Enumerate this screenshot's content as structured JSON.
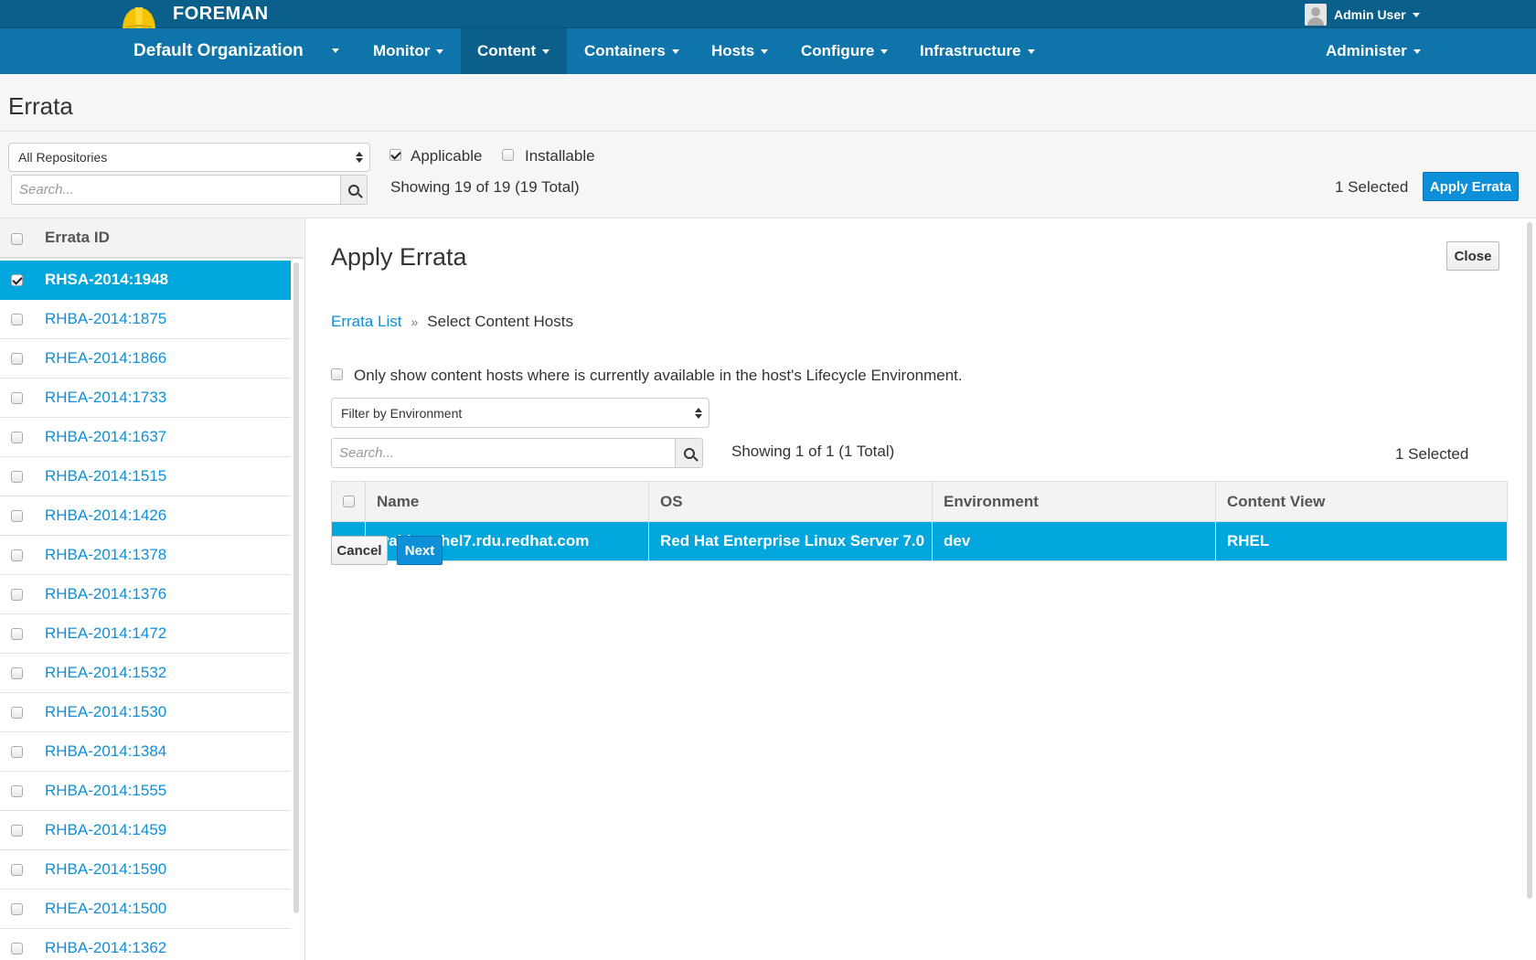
{
  "header": {
    "brand": "FOREMAN",
    "user": "Admin User",
    "org": "Default Organization",
    "nav": [
      "Monitor",
      "Content",
      "Containers",
      "Hosts",
      "Configure",
      "Infrastructure",
      "Administer"
    ],
    "active_nav": "Content"
  },
  "page": {
    "title": "Errata"
  },
  "toolbar": {
    "repo_select": "All Repositories",
    "search_placeholder": "Search...",
    "applicable_label": "Applicable",
    "applicable_checked": true,
    "installable_label": "Installable",
    "installable_checked": false,
    "showing": "Showing 19 of 19 (19 Total)",
    "selected": "1 Selected",
    "apply_button": "Apply Errata"
  },
  "errata_list": {
    "header": "Errata ID",
    "items": [
      {
        "id": "RHSA-2014:1948",
        "selected": true
      },
      {
        "id": "RHBA-2014:1875"
      },
      {
        "id": "RHEA-2014:1866"
      },
      {
        "id": "RHEA-2014:1733"
      },
      {
        "id": "RHBA-2014:1637"
      },
      {
        "id": "RHBA-2014:1515"
      },
      {
        "id": "RHBA-2014:1426"
      },
      {
        "id": "RHBA-2014:1378"
      },
      {
        "id": "RHBA-2014:1376"
      },
      {
        "id": "RHEA-2014:1472"
      },
      {
        "id": "RHEA-2014:1532"
      },
      {
        "id": "RHEA-2014:1530"
      },
      {
        "id": "RHBA-2014:1384"
      },
      {
        "id": "RHBA-2014:1555"
      },
      {
        "id": "RHBA-2014:1459"
      },
      {
        "id": "RHBA-2014:1590"
      },
      {
        "id": "RHEA-2014:1500"
      },
      {
        "id": "RHBA-2014:1362"
      }
    ]
  },
  "apply_panel": {
    "title": "Apply Errata",
    "close_button": "Close",
    "breadcrumb_link": "Errata List",
    "breadcrumb_sep": "»",
    "breadcrumb_current": "Select Content Hosts",
    "only_show_label": "Only show content hosts where is currently available in the host's Lifecycle Environment.",
    "env_select": "Filter by Environment",
    "search_placeholder": "Search...",
    "showing": "Showing 1 of 1 (1 Total)",
    "selected": "1 Selected",
    "columns": [
      "Name",
      "OS",
      "Environment",
      "Content View"
    ],
    "rows": [
      {
        "name": "walden-rhel7.rdu.redhat.com",
        "os": "Red Hat Enterprise Linux Server 7.0",
        "environment": "dev",
        "content_view": "RHEL"
      }
    ],
    "cancel_button": "Cancel",
    "next_button": "Next"
  }
}
